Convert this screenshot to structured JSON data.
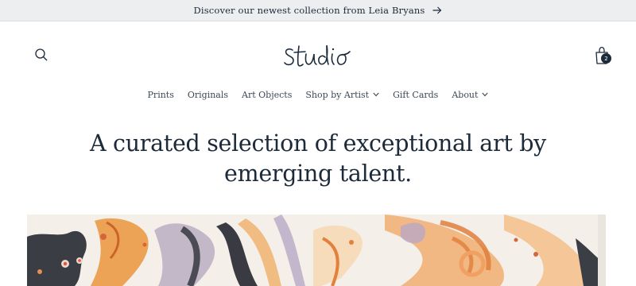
{
  "announcement": {
    "text": "Discover our newest collection from Leia Bryans",
    "arrow_icon": "arrow-right-icon"
  },
  "header": {
    "logo_text": "Studio",
    "search_icon": "search-icon",
    "cart_icon": "shopping-bag-icon",
    "cart_count": "2"
  },
  "nav": {
    "items": [
      {
        "label": "Prints",
        "has_dropdown": false
      },
      {
        "label": "Originals",
        "has_dropdown": false
      },
      {
        "label": "Art Objects",
        "has_dropdown": false
      },
      {
        "label": "Shop by Artist",
        "has_dropdown": true
      },
      {
        "label": "Gift Cards",
        "has_dropdown": false
      },
      {
        "label": "About",
        "has_dropdown": true
      }
    ]
  },
  "hero": {
    "title_line1": "A curated selection of exceptional art by",
    "title_line2": "emerging talent."
  },
  "colors": {
    "text": "#1c2a3a",
    "announcement_bg": "#eceef0",
    "accent_orange": "#e8893c"
  }
}
